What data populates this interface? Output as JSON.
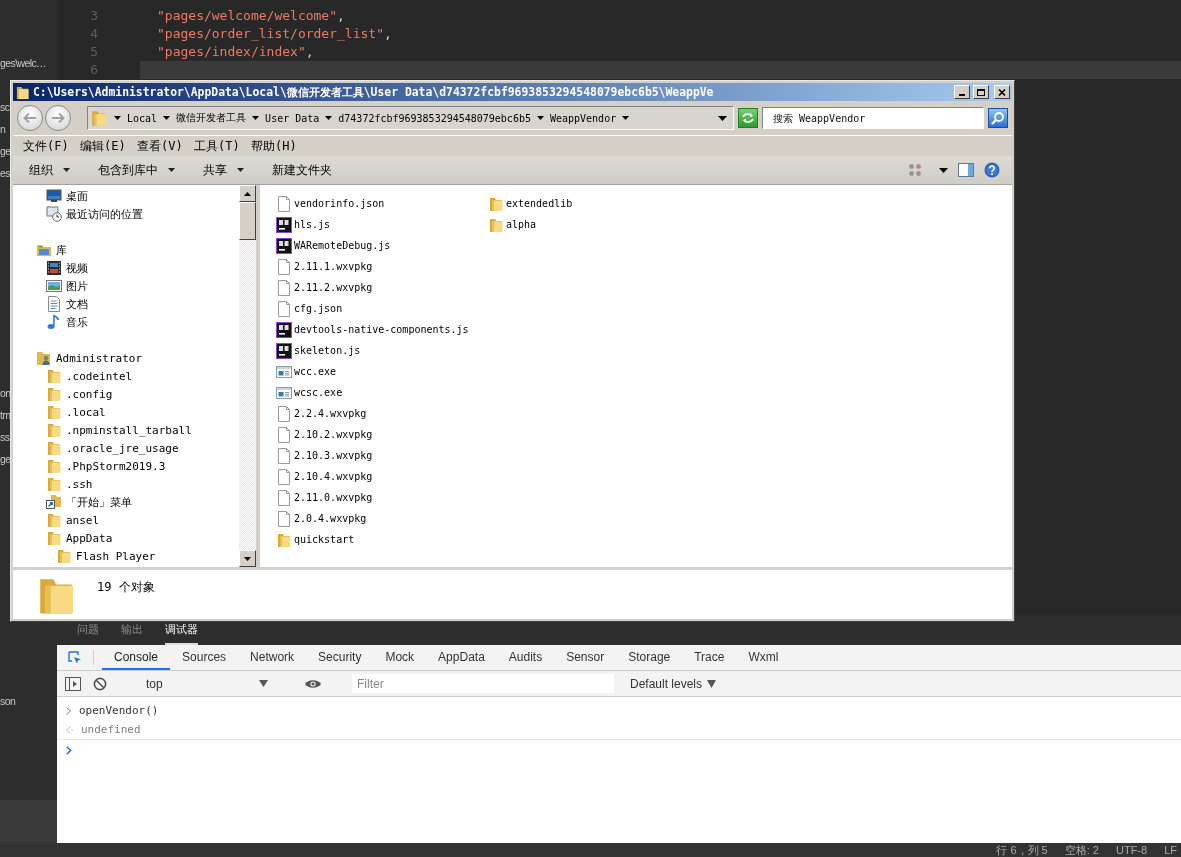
{
  "sidebar": {
    "items": [
      {
        "text": "ges\\welc…"
      },
      {
        "text": "sc"
      },
      {
        "text": "n"
      },
      {
        "text": "ge"
      },
      {
        "text": "es"
      },
      {
        "text": "on"
      },
      {
        "text": "tm"
      },
      {
        "text": "ss"
      },
      {
        "text": "ge"
      },
      {
        "text": "son"
      }
    ]
  },
  "editor": {
    "lines": [
      {
        "number": "3",
        "code": "\"pages/welcome/welcome\",",
        "current": false
      },
      {
        "number": "4",
        "code": "\"pages/order_list/order_list\",",
        "current": false
      },
      {
        "number": "5",
        "code": "\"pages/index/index\",",
        "current": false
      },
      {
        "number": "6",
        "current": true
      }
    ]
  },
  "explorer": {
    "title": "C:\\Users\\Administrator\\AppData\\Local\\微信开发者工具\\User Data\\d74372fcbf9693853294548079ebc6b5\\WeappVe",
    "address": {
      "crumbs": [
        "Local",
        "微信开发者工具",
        "User Data",
        "d74372fcbf9693853294548079ebc6b5",
        "WeappVendor"
      ]
    },
    "search": {
      "placeholder": "搜索 WeappVendor"
    },
    "menu": [
      "文件(F)",
      "编辑(E)",
      "查看(V)",
      "工具(T)",
      "帮助(H)"
    ],
    "toolbar": [
      {
        "label": "组织",
        "dropdown": true
      },
      {
        "label": "包含到库中",
        "dropdown": true
      },
      {
        "label": "共享",
        "dropdown": true
      },
      {
        "label": "新建文件夹",
        "dropdown": false
      }
    ],
    "favorites": [
      {
        "label": "桌面",
        "kind": "desktop"
      },
      {
        "label": "最近访问的位置",
        "kind": "recent"
      }
    ],
    "tree": [
      {
        "label": "库",
        "kind": "library",
        "children": [
          {
            "label": "视频",
            "kind": "video"
          },
          {
            "label": "图片",
            "kind": "pictures"
          },
          {
            "label": "文档",
            "kind": "documents"
          },
          {
            "label": "音乐",
            "kind": "music"
          }
        ]
      },
      {
        "label": "Administrator",
        "kind": "user",
        "children": [
          {
            "label": ".codeintel",
            "kind": "folder"
          },
          {
            "label": ".config",
            "kind": "folder"
          },
          {
            "label": ".local",
            "kind": "folder"
          },
          {
            "label": ".npminstall_tarball",
            "kind": "folder"
          },
          {
            "label": ".oracle_jre_usage",
            "kind": "folder"
          },
          {
            "label": ".PhpStorm2019.3",
            "kind": "folder"
          },
          {
            "label": ".ssh",
            "kind": "folder"
          },
          {
            "label": "「开始」菜单",
            "kind": "shortcut"
          },
          {
            "label": "ansel",
            "kind": "folder"
          },
          {
            "label": "AppData",
            "kind": "folder",
            "children": [
              {
                "label": "Flash Player",
                "kind": "folder"
              }
            ]
          }
        ]
      }
    ],
    "files": [
      {
        "name": "vendorinfo.json",
        "kind": "file"
      },
      {
        "name": "hls.js",
        "kind": "app"
      },
      {
        "name": "WARemoteDebug.js",
        "kind": "app"
      },
      {
        "name": "2.11.1.wxvpkg",
        "kind": "file"
      },
      {
        "name": "2.11.2.wxvpkg",
        "kind": "file"
      },
      {
        "name": "cfg.json",
        "kind": "file"
      },
      {
        "name": "devtools-native-components.js",
        "kind": "app"
      },
      {
        "name": "skeleton.js",
        "kind": "app"
      },
      {
        "name": "wcc.exe",
        "kind": "exe"
      },
      {
        "name": "wcsc.exe",
        "kind": "exe"
      },
      {
        "name": "2.2.4.wxvpkg",
        "kind": "file"
      },
      {
        "name": "2.10.2.wxvpkg",
        "kind": "file"
      },
      {
        "name": "2.10.3.wxvpkg",
        "kind": "file"
      },
      {
        "name": "2.10.4.wxvpkg",
        "kind": "file"
      },
      {
        "name": "2.11.0.wxvpkg",
        "kind": "file"
      },
      {
        "name": "2.0.4.wxvpkg",
        "kind": "file"
      },
      {
        "name": "quickstart",
        "kind": "folder"
      },
      {
        "name": "extendedlib",
        "kind": "folder"
      },
      {
        "name": "alpha",
        "kind": "folder"
      }
    ],
    "status": "19 个对象"
  },
  "panel_tabs": [
    {
      "label": "问题",
      "selected": false
    },
    {
      "label": "输出",
      "selected": false
    },
    {
      "label": "调试器",
      "selected": true
    }
  ],
  "devtools": {
    "tabs": [
      {
        "label": "Console",
        "selected": true
      },
      {
        "label": "Sources",
        "selected": false
      },
      {
        "label": "Network",
        "selected": false
      },
      {
        "label": "Security",
        "selected": false
      },
      {
        "label": "Mock",
        "selected": false
      },
      {
        "label": "AppData",
        "selected": false
      },
      {
        "label": "Audits",
        "selected": false
      },
      {
        "label": "Sensor",
        "selected": false
      },
      {
        "label": "Storage",
        "selected": false
      },
      {
        "label": "Trace",
        "selected": false
      },
      {
        "label": "Wxml",
        "selected": false
      }
    ],
    "context": "top",
    "filter": {
      "placeholder": "Filter"
    },
    "levels": "Default levels",
    "console": [
      {
        "kind": "input",
        "text": "openVendor()"
      },
      {
        "kind": "output",
        "text": "undefined"
      },
      {
        "kind": "prompt"
      }
    ]
  },
  "status_bar": {
    "items": [
      "行 6，列 5",
      "空格: 2",
      "UTF-8",
      "LF"
    ]
  }
}
